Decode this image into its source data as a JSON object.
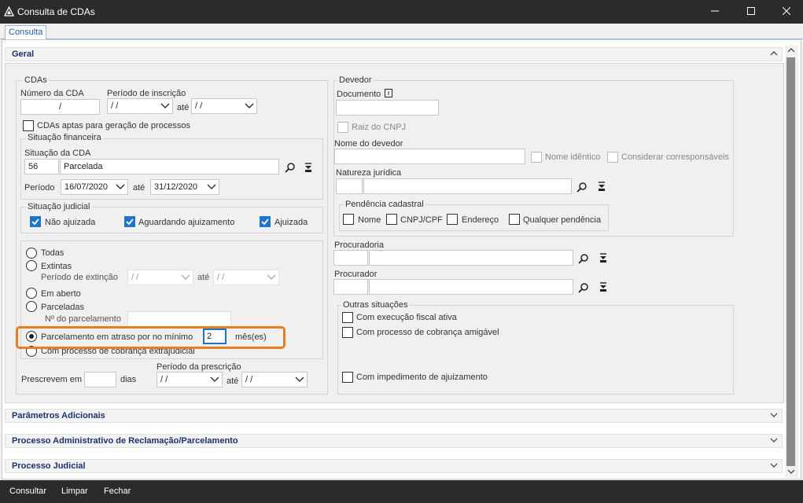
{
  "window": {
    "title": "Consulta de CDAs",
    "minimize": "—",
    "maximize": "☐",
    "close": "✕"
  },
  "tabs": {
    "consulta": "Consulta"
  },
  "sections": {
    "geral": "Geral",
    "parametros": "Parâmetros Adicionais",
    "processo_adm": "Processo Administrativo de Reclamação/Parcelamento",
    "processo_judicial": "Processo Judicial"
  },
  "cdas": {
    "group": "CDAs",
    "numero_label": "Número da CDA",
    "numero_value": "/",
    "periodo_label": "Período de inscrição",
    "periodo_from": " / /",
    "periodo_to": " / /",
    "ate": "até",
    "aptas_label": "CDAs aptas para geração de processos"
  },
  "situacao_financeira": {
    "group": "Situação financeira",
    "situacao_label": "Situação da CDA",
    "codigo": "56",
    "descricao": "Parcelada",
    "periodo_label": "Período",
    "periodo_from": "16/07/2020",
    "ate": "até",
    "periodo_to": "31/12/2020"
  },
  "situacao_judicial": {
    "group": "Situação judicial",
    "nao_ajuizada": "Não ajuizada",
    "aguardando": "Aguardando ajuizamento",
    "ajuizada": "Ajuizada"
  },
  "status": {
    "todas": "Todas",
    "extintas": "Extintas",
    "periodo_extincao": "Período de extinção",
    "ext_from": " / /",
    "ate": "até",
    "ext_to": " / /",
    "em_aberto": "Em aberto",
    "parceladas": "Parceladas",
    "n_parcelamento": "Nº do parcelamento",
    "parcelamento_atraso": "Parcelamento em atraso por no mínimo",
    "meses_value": "2",
    "meses_label": "mês(es)",
    "cobranca_extrajudicial": "Com processo de cobrança extrajudicial"
  },
  "prescricao": {
    "prescrevem_label": "Prescrevem em",
    "dias": "dias",
    "periodo_label": "Período da prescrição",
    "from": " / /",
    "ate": "até",
    "to": " / /"
  },
  "devedor": {
    "group": "Devedor",
    "documento_label": "Documento",
    "raiz_cnpj": "Raiz do CNPJ",
    "nome_label": "Nome do devedor",
    "nome_identico": "Nome idêntico",
    "considerar": "Considerar corresponsáveis",
    "natureza_label": "Natureza jurídica",
    "pendencia_group": "Pendência cadastral",
    "pend_nome": "Nome",
    "pend_cnpj": "CNPJ/CPF",
    "pend_endereco": "Endereço",
    "pend_qualquer": "Qualquer pendência"
  },
  "procuradoria_label": "Procuradoria",
  "procurador_label": "Procurador",
  "outras": {
    "group": "Outras situações",
    "execucao": "Com execução fiscal ativa",
    "cobranca": "Com processo de cobrança amigável",
    "impedimento": "Com impedimento de ajuizamento"
  },
  "footer": {
    "consultar": "Consultar",
    "limpar": "Limpar",
    "fechar": "Fechar"
  }
}
